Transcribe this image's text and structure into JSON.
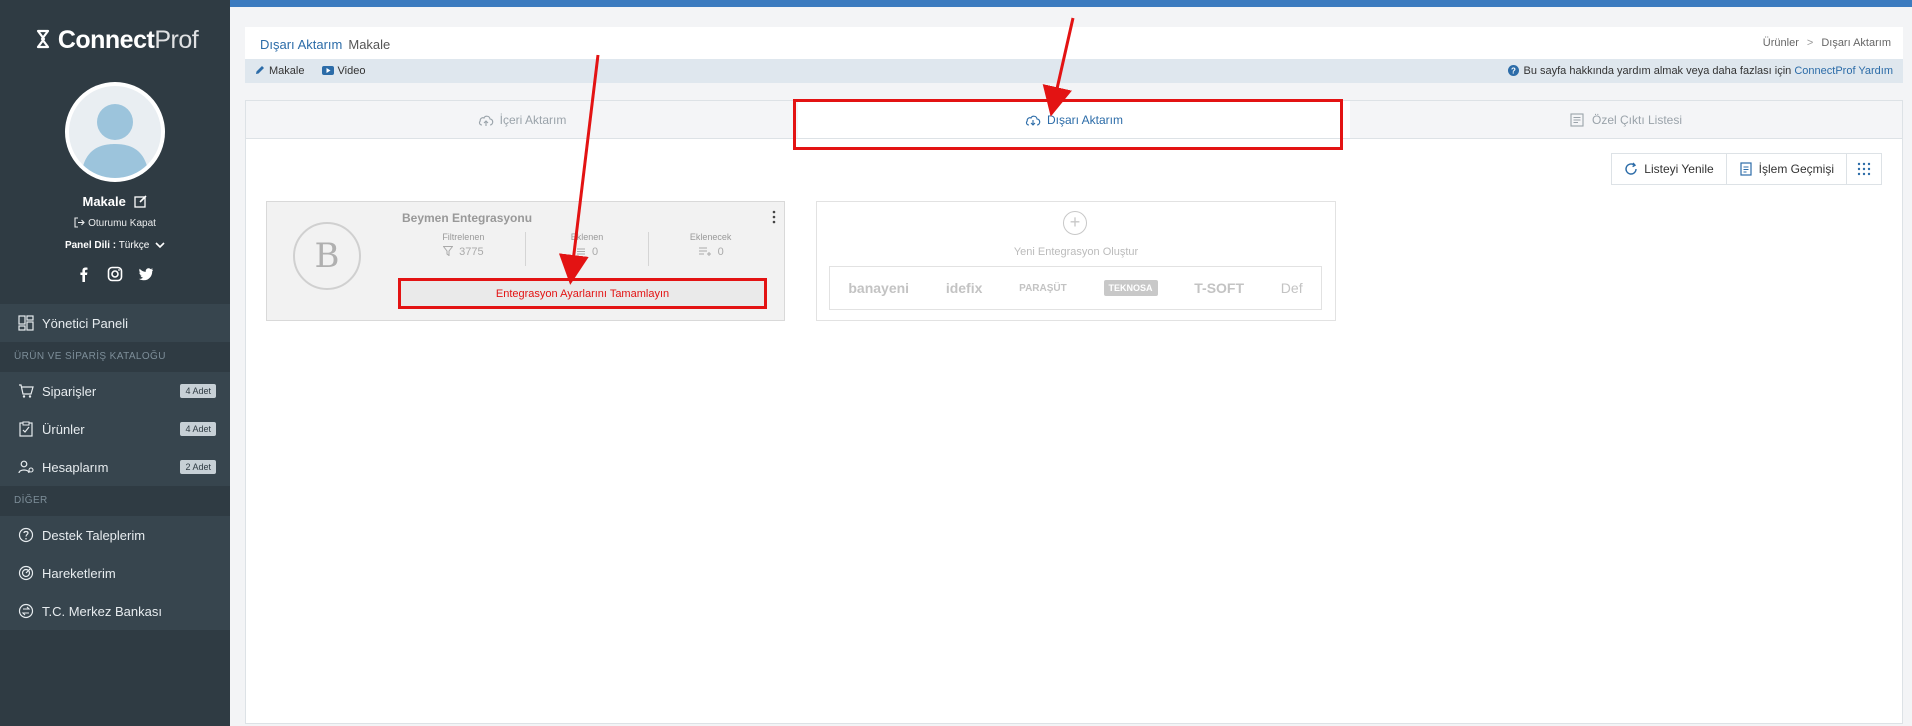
{
  "sidebar": {
    "brand_bold": "Connect",
    "brand_light": "Prof",
    "user_name": "Makale",
    "logout": "Oturumu Kapat",
    "panel_lang_label": "Panel Dili :",
    "panel_lang_value": "Türkçe",
    "items": [
      {
        "label": "Yönetici Paneli",
        "icon": "dashboard-icon"
      },
      {
        "section": "ÜRÜN VE SİPARİŞ KATALOĞU"
      },
      {
        "label": "Siparişler",
        "badge": "4 Adet",
        "icon": "cart-icon"
      },
      {
        "label": "Ürünler",
        "badge": "4 Adet",
        "icon": "clipboard-icon"
      },
      {
        "label": "Hesaplarım",
        "badge": "2 Adet",
        "icon": "accounts-icon"
      },
      {
        "section": "DİĞER"
      },
      {
        "label": "Destek Taleplerim",
        "icon": "help-icon"
      },
      {
        "label": "Hareketlerim",
        "icon": "radar-icon"
      },
      {
        "label": "T.C. Merkez Bankası",
        "icon": "exchange-icon"
      }
    ]
  },
  "header": {
    "title": "Dışarı Aktarım",
    "subtitle": "Makale",
    "breadcrumb_1": "Ürünler",
    "breadcrumb_sep": ">",
    "breadcrumb_2": "Dışarı Aktarım",
    "link_article": "Makale",
    "link_video": "Video",
    "help_text": "Bu sayfa hakkında yardım almak veya daha fazlası için",
    "help_link": "ConnectProf Yardım"
  },
  "tabs": [
    {
      "label": "İçeri Aktarım",
      "icon": "cloud-upload-icon"
    },
    {
      "label": "Dışarı Aktarım",
      "icon": "cloud-download-icon",
      "active": true
    },
    {
      "label": "Özel Çıktı Listesi",
      "icon": "list-icon"
    }
  ],
  "toolbar": {
    "refresh": "Listeyi Yenile",
    "history": "İşlem Geçmişi"
  },
  "integration": {
    "logo_letter": "B",
    "name": "Beymen Entegrasyonu",
    "stats": [
      {
        "label": "Filtrelenen",
        "value": "3775"
      },
      {
        "label": "Eklenen",
        "value": "0"
      },
      {
        "label": "Eklenecek",
        "value": "0"
      }
    ],
    "cta": "Entegrasyon Ayarlarını Tamamlayın"
  },
  "new_integration": {
    "plus": "+",
    "label": "Yeni Entegrasyon Oluştur",
    "marketplaces": [
      "banayeni",
      "idefix",
      "PARAŞÜT",
      "TEKNOSA",
      "T-SOFT",
      "Def"
    ]
  },
  "colors": {
    "sidebar_bg": "#2f3b43",
    "accent": "#2c6ca8",
    "highlight": "#e31313"
  }
}
